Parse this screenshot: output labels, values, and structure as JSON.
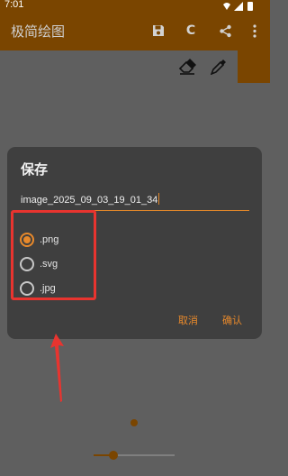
{
  "status_bar": {
    "time": "7:01",
    "icons": [
      "wifi-icon",
      "signal-icon",
      "battery-icon"
    ]
  },
  "app_bar": {
    "title": "极简绘图",
    "actions": [
      {
        "name": "save-icon",
        "label": ""
      },
      {
        "name": "clear-icon",
        "label": "C"
      },
      {
        "name": "share-icon",
        "label": ""
      },
      {
        "name": "more-vert-icon",
        "label": ""
      }
    ]
  },
  "tools": [
    "eraser-icon",
    "color-picker-icon"
  ],
  "dialog": {
    "title": "保存",
    "filename": "image_2025_09_03_19_01_34",
    "formats": [
      {
        "label": ".png",
        "checked": true
      },
      {
        "label": ".svg",
        "checked": false
      },
      {
        "label": ".jpg",
        "checked": false
      }
    ],
    "cancel_label": "取消",
    "confirm_label": "确认"
  },
  "brush_size_slider": {
    "level": 0.2
  },
  "colors": {
    "primary": "#7a4500",
    "accent": "#e8892b",
    "dialog_bg": "#3f3f3f",
    "annotation": "#e8342f"
  }
}
